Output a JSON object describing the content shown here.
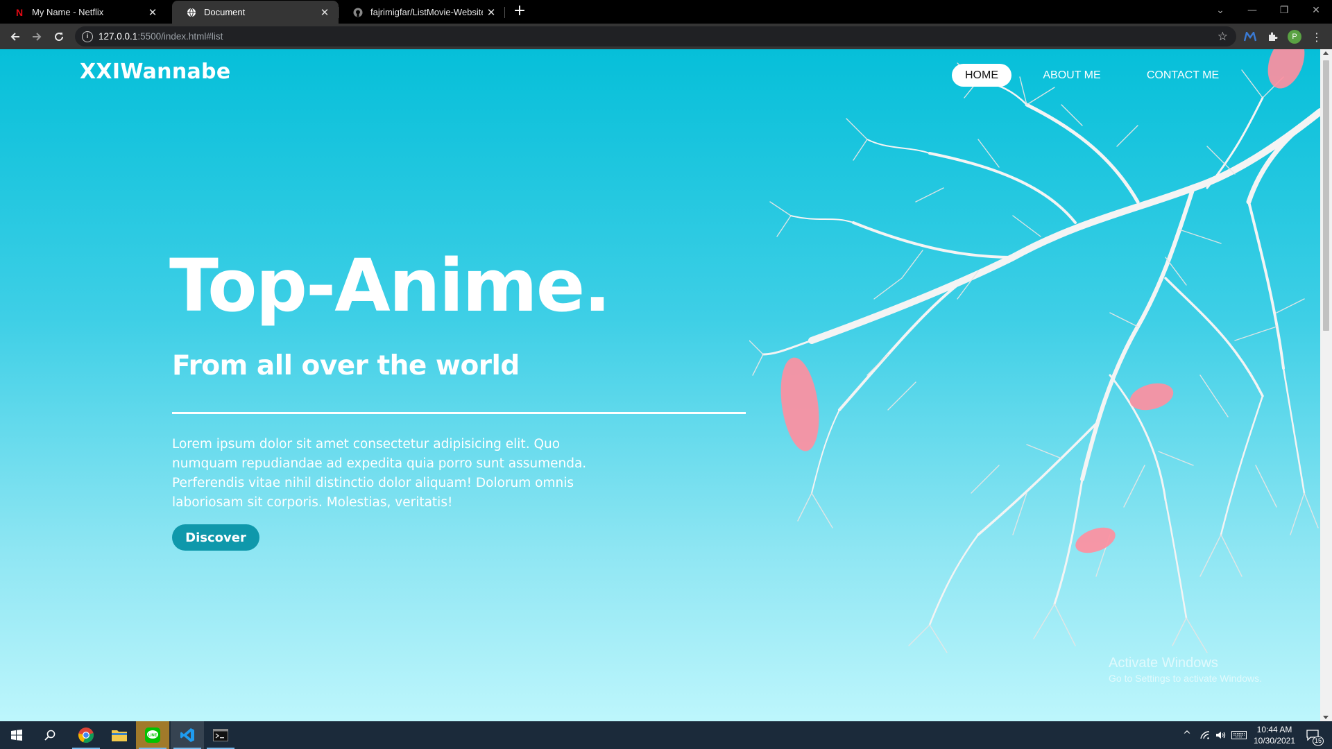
{
  "browser": {
    "tabs": [
      {
        "title": "My Name - Netflix",
        "icon": "netflix-icon"
      },
      {
        "title": "Document",
        "icon": "globe-icon"
      },
      {
        "title": "fajrimigfar/ListMovie-Website",
        "icon": "github-icon"
      }
    ],
    "active_tab": 1,
    "url_host": "127.0.0.1",
    "url_path": ":5500/index.html#list",
    "profile_initial": "P"
  },
  "page": {
    "brand": "XXIWannabe",
    "nav": [
      {
        "label": "HOME",
        "active": true
      },
      {
        "label": "ABOUT ME",
        "active": false
      },
      {
        "label": "CONTACT ME",
        "active": false
      }
    ],
    "hero_title": "Top-Anime.",
    "hero_subtitle": "From all over the world",
    "hero_body": "Lorem ipsum dolor sit amet consectetur adipisicing elit. Quo numquam repudiandae ad expedita quia porro sunt assumenda. Perferendis vitae nihil distinctio dolor aliquam! Dolorum omnis laboriosam sit corporis. Molestias, veritatis!",
    "cta": "Discover",
    "colors": {
      "bg_top": "#06bfd9",
      "bg_bottom": "#bdf6fc",
      "cta_bg": "#0f98ab",
      "petal": "#ff8fa0"
    }
  },
  "watermark": {
    "title": "Activate Windows",
    "subtitle": "Go to Settings to activate Windows."
  },
  "taskbar": {
    "apps": [
      "windows-start-icon",
      "search-icon",
      "chrome-icon",
      "file-explorer-icon",
      "line-icon",
      "vscode-icon",
      "terminal-icon"
    ],
    "time": "10:44 AM",
    "date": "10/30/2021",
    "notification_count": "15"
  }
}
